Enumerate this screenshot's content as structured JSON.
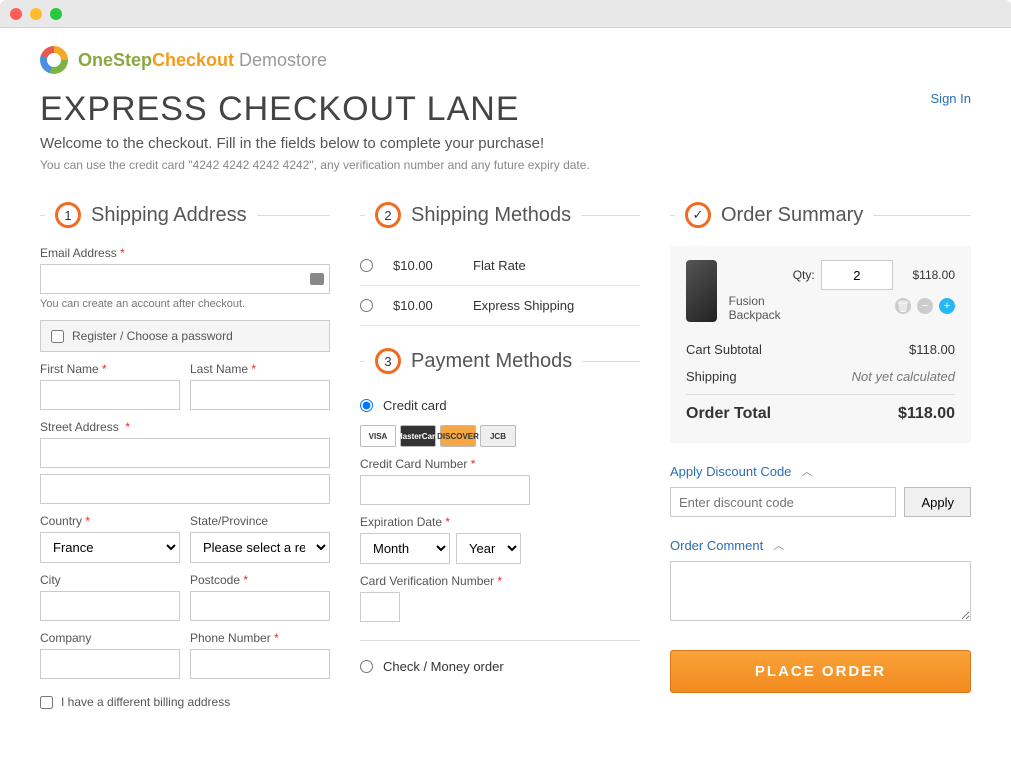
{
  "logo": {
    "brand_one": "OneStep",
    "brand_chk": "Checkout",
    "brand_demo": " Demostore"
  },
  "header": {
    "title": "EXPRESS CHECKOUT LANE",
    "welcome": "Welcome to the checkout. Fill in the fields below to complete your purchase!",
    "hint": "You can use the credit card \"4242 4242 4242 4242\", any verification number and any future expiry date.",
    "signin": "Sign In"
  },
  "sections": {
    "shipping_address": {
      "badge": "1",
      "title": "Shipping Address"
    },
    "shipping_methods": {
      "badge": "2",
      "title": "Shipping Methods"
    },
    "payment_methods": {
      "badge": "3",
      "title": "Payment Methods"
    },
    "order_summary": {
      "badge": "✓",
      "title": "Order Summary"
    }
  },
  "shipping_address": {
    "email_label": "Email Address",
    "email_note": "You can create an account after checkout.",
    "register_label": "Register / Choose a password",
    "first_name_label": "First Name",
    "last_name_label": "Last Name",
    "street_label": "Street Address",
    "country_label": "Country",
    "country_value": "France",
    "state_label": "State/Province",
    "state_placeholder": "Please select a region, state or province",
    "city_label": "City",
    "postcode_label": "Postcode",
    "company_label": "Company",
    "phone_label": "Phone Number",
    "diff_billing_label": "I have a different billing address"
  },
  "shipping_methods": [
    {
      "price": "$10.00",
      "name": "Flat Rate",
      "selected": false
    },
    {
      "price": "$10.00",
      "name": "Express Shipping",
      "selected": false
    }
  ],
  "payment": {
    "credit_card_label": "Credit card",
    "check_label": "Check / Money order",
    "cc_number_label": "Credit Card Number",
    "exp_label": "Expiration Date",
    "exp_month_placeholder": "Month",
    "exp_year_placeholder": "Year",
    "cvv_label": "Card Verification Number",
    "brands": [
      "VISA",
      "MasterCard",
      "DISCOVER",
      "JCB"
    ]
  },
  "summary": {
    "item": {
      "name": "Fusion Backpack",
      "qty_label": "Qty:",
      "qty": "2",
      "line_total": "$118.00"
    },
    "subtotal_label": "Cart Subtotal",
    "subtotal_value": "$118.00",
    "shipping_label": "Shipping",
    "shipping_value": "Not yet calculated",
    "grand_label": "Order Total",
    "grand_value": "$118.00",
    "discount_head": "Apply Discount Code",
    "discount_placeholder": "Enter discount code",
    "apply_label": "Apply",
    "comment_head": "Order Comment",
    "place_order_label": "PLACE ORDER"
  },
  "required_marker": "*"
}
